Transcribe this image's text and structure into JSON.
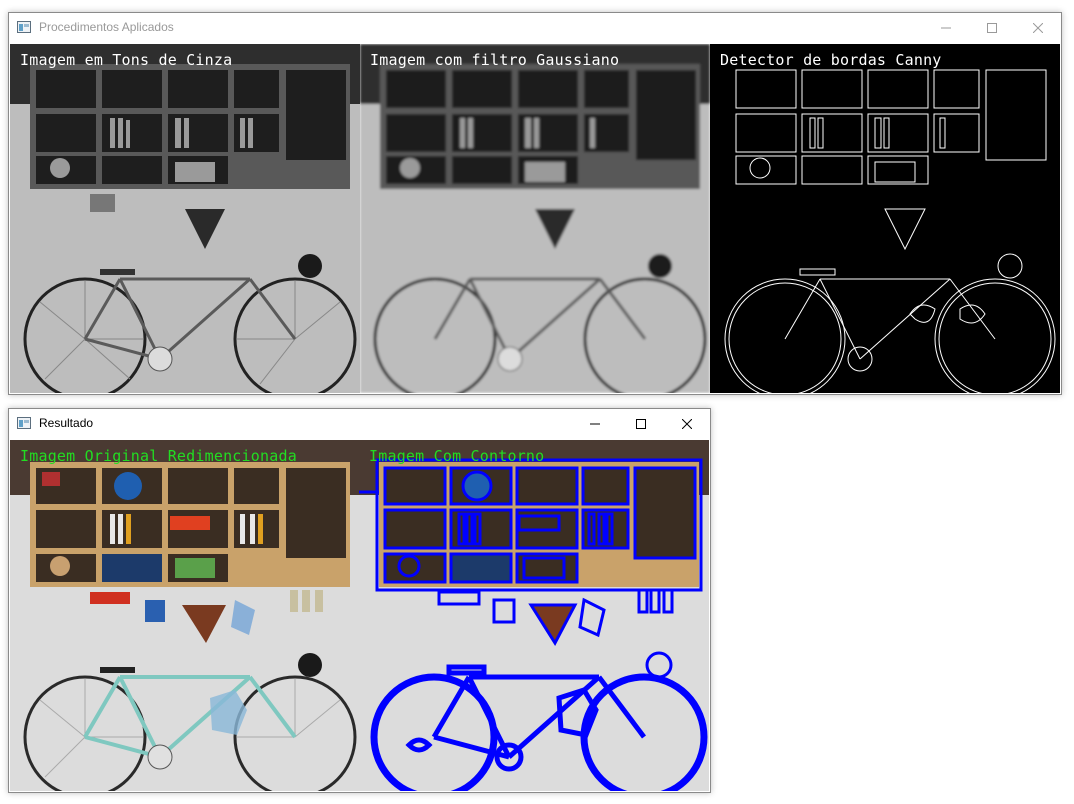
{
  "windows": {
    "procedimentos": {
      "title": "Procedimentos Aplicados",
      "title_color": "#999999",
      "controls": [
        "minimize-icon",
        "maximize-icon",
        "close-icon"
      ],
      "panels": [
        {
          "caption": "Imagem em Tons de Cinza",
          "caption_color": "#ffffff",
          "style": "grayscale"
        },
        {
          "caption": "Imagem com filtro Gaussiano",
          "caption_color": "#ffffff",
          "style": "blurred"
        },
        {
          "caption": "Detector de bordas Canny",
          "caption_color": "#ffffff",
          "style": "edges"
        }
      ]
    },
    "resultado": {
      "title": "Resultado",
      "title_color": "#000000",
      "controls": [
        "minimize-icon",
        "maximize-icon",
        "close-icon"
      ],
      "panels": [
        {
          "caption": "Imagem Original Redimencionada",
          "caption_color": "#22dd22",
          "style": "color"
        },
        {
          "caption": "Imagem Com Contorno",
          "caption_color": "#22dd22",
          "style": "contour"
        }
      ]
    }
  },
  "colors": {
    "contour": "#0000ff",
    "frame_tint": "#c8e0e0",
    "shelf_wood": "#c9a26a"
  }
}
